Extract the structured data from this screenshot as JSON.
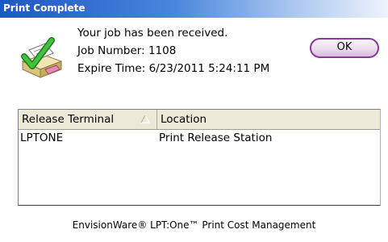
{
  "window": {
    "title": "Print Complete"
  },
  "message": {
    "received": "Your job has been received.",
    "job_number_label": "Job Number:",
    "job_number": "1108",
    "expire_label": "Expire Time:",
    "expire_time": "6/23/2011 5:24:11 PM"
  },
  "buttons": {
    "ok_label": "OK"
  },
  "table": {
    "columns": [
      "Release Terminal",
      "Location"
    ],
    "sorted_column": "Release Terminal",
    "sort_direction": "ascending",
    "rows": [
      {
        "terminal": "LPTONE",
        "location": "Print Release Station"
      }
    ]
  },
  "footer": {
    "text": "EnvisionWare® LPT:One™ Print Cost Management"
  },
  "icons": {
    "app": "printer-checkmark-icon",
    "sort": "sort-ascending-icon"
  },
  "colors": {
    "titlebar": "#1d57c3",
    "ok_border": "#8a3a9a",
    "header_bg": "#ece9d8",
    "check": "#2e9e2e"
  }
}
